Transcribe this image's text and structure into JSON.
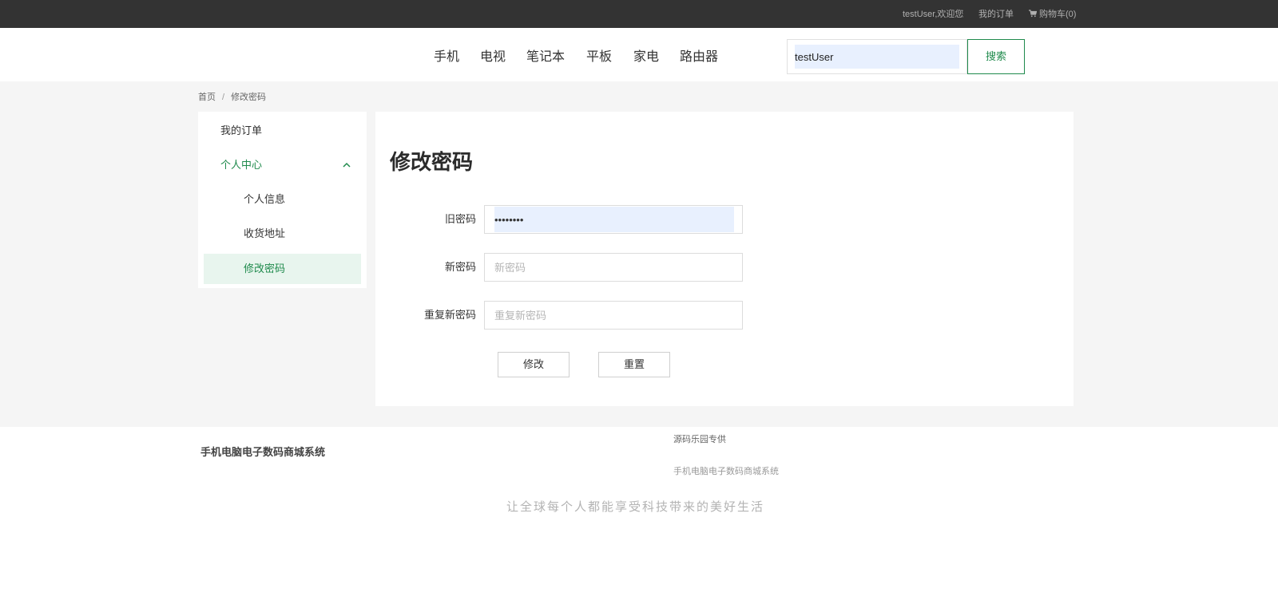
{
  "topbar": {
    "welcome": "testUser,欢迎您",
    "orders_link": "我的订单",
    "cart_label": "购物车(0)"
  },
  "nav": {
    "items": [
      "手机",
      "电视",
      "笔记本",
      "平板",
      "家电",
      "路由器"
    ]
  },
  "search": {
    "value": "testUser",
    "button_label": "搜索"
  },
  "breadcrumb": {
    "home": "首页",
    "separator": "/",
    "current": "修改密码"
  },
  "sidebar": {
    "orders": "我的订单",
    "personal_center": "个人中心",
    "sub_items": [
      "个人信息",
      "收货地址",
      "修改密码"
    ],
    "active_item": "修改密码"
  },
  "form": {
    "title": "修改密码",
    "old_password_label": "旧密码",
    "old_password_value": "••••••••",
    "new_password_label": "新密码",
    "new_password_placeholder": "新密码",
    "repeat_password_label": "重复新密码",
    "repeat_password_placeholder": "重复新密码",
    "submit_label": "修改",
    "reset_label": "重置"
  },
  "footer": {
    "brand": "手机电脑电子数码商城系统",
    "credit": "源码乐园专供",
    "system_name": "手机电脑电子数码商城系统",
    "slogan": "让全球每个人都能享受科技带来的美好生活"
  },
  "colors": {
    "accent": "#1f8a4c",
    "topbar_bg": "#333333",
    "active_bg": "#e8f5ee",
    "page_bg": "#f5f5f5"
  }
}
